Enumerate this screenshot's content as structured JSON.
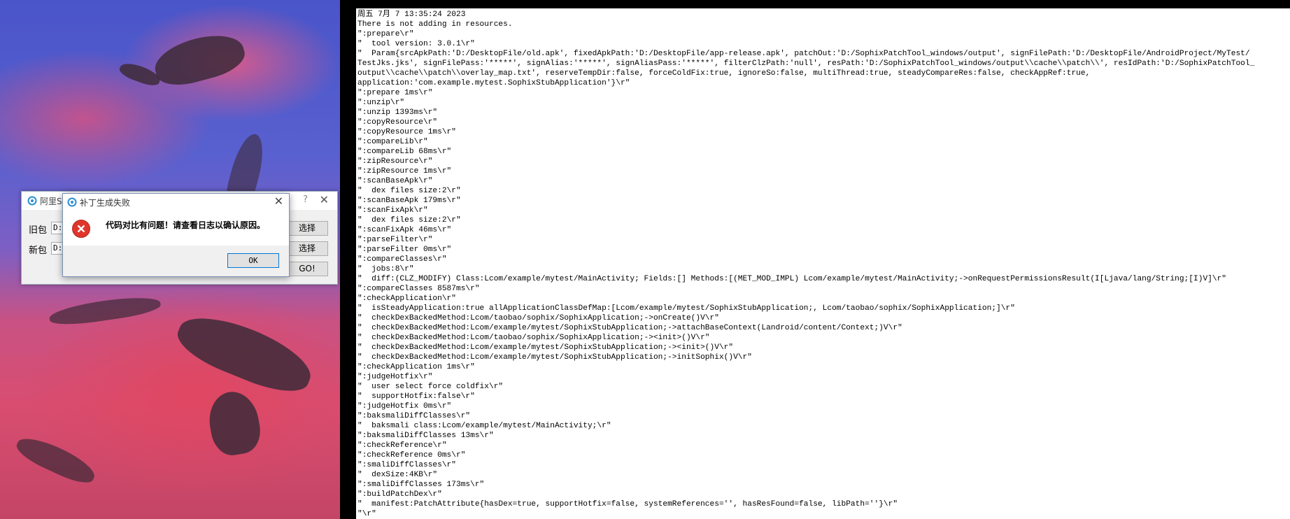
{
  "tool_window": {
    "title": "阿里S",
    "old_label": "旧包",
    "new_label": "新包",
    "old_path": "D:",
    "new_path": "D:",
    "select_button_1": "选择",
    "select_button_2": "选择",
    "go_button": "GO!",
    "help_icon": "question-icon",
    "close_icon": "close-icon"
  },
  "error_dialog": {
    "title": "补丁生成失败",
    "message": "代码对比有问题！请查看日志以确认原因。",
    "ok_button": "OK",
    "icon": "error-icon",
    "close_icon": "close-icon"
  },
  "console": {
    "lines": [
      "周五 7月 7 13:35:24 2023",
      "There is not adding in resources.",
      "\":prepare\\r\"",
      "\"  tool version: 3.0.1\\r\"",
      "\"  Param{srcApkPath:'D:/DesktopFile/old.apk', fixedApkPath:'D:/DesktopFile/app-release.apk', patchOut:'D:/SophixPatchTool_windows/output', signFilePath:'D:/DesktopFile/AndroidProject/MyTest/",
      "TestJks.jks', signFilePass:'*****', signAlias:'*****', signAliasPass:'*****', filterClzPath:'null', resPath:'D:/SophixPatchTool_windows/output\\\\cache\\\\patch\\\\', resIdPath:'D:/SophixPatchTool_",
      "output\\\\cache\\\\patch\\\\overlay_map.txt', reserveTempDir:false, forceColdFix:true, ignoreSo:false, multiThread:true, steadyCompareRes:false, checkAppRef:true,",
      "application:'com.example.mytest.SophixStubApplication'}\\r\"",
      "\":prepare 1ms\\r\"",
      "\":unzip\\r\"",
      "\":unzip 1393ms\\r\"",
      "\":copyResource\\r\"",
      "\":copyResource 1ms\\r\"",
      "\":compareLib\\r\"",
      "\":compareLib 68ms\\r\"",
      "\":zipResource\\r\"",
      "\":zipResource 1ms\\r\"",
      "\":scanBaseApk\\r\"",
      "\"  dex files size:2\\r\"",
      "\":scanBaseApk 179ms\\r\"",
      "\":scanFixApk\\r\"",
      "\"  dex files size:2\\r\"",
      "\":scanFixApk 46ms\\r\"",
      "\":parseFilter\\r\"",
      "\":parseFilter 0ms\\r\"",
      "\":compareClasses\\r\"",
      "\"  jobs:8\\r\"",
      "\"  diff:(CLZ_MODIFY) Class:Lcom/example/mytest/MainActivity; Fields:[] Methods:[(MET_MOD_IMPL) Lcom/example/mytest/MainActivity;->onRequestPermissionsResult(I[Ljava/lang/String;[I)V]\\r\"",
      "\":compareClasses 8587ms\\r\"",
      "\":checkApplication\\r\"",
      "\"  isSteadyApplication:true allApplicationClassDefMap:[Lcom/example/mytest/SophixStubApplication;, Lcom/taobao/sophix/SophixApplication;]\\r\"",
      "\"  checkDexBackedMethod:Lcom/taobao/sophix/SophixApplication;->onCreate()V\\r\"",
      "\"  checkDexBackedMethod:Lcom/example/mytest/SophixStubApplication;->attachBaseContext(Landroid/content/Context;)V\\r\"",
      "\"  checkDexBackedMethod:Lcom/taobao/sophix/SophixApplication;-><init>()V\\r\"",
      "\"  checkDexBackedMethod:Lcom/example/mytest/SophixStubApplication;-><init>()V\\r\"",
      "\"  checkDexBackedMethod:Lcom/example/mytest/SophixStubApplication;->initSophix()V\\r\"",
      "\":checkApplication 1ms\\r\"",
      "\":judgeHotfix\\r\"",
      "\"  user select force coldfix\\r\"",
      "\"  supportHotfix:false\\r\"",
      "\":judgeHotfix 0ms\\r\"",
      "\":baksmaliDiffClasses\\r\"",
      "\"  baksmali class:Lcom/example/mytest/MainActivity;\\r\"",
      "\":baksmaliDiffClasses 13ms\\r\"",
      "\":checkReference\\r\"",
      "\":checkReference 0ms\\r\"",
      "\":smaliDiffClasses\\r\"",
      "\"  dexSize:4KB\\r\"",
      "\":smaliDiffClasses 173ms\\r\"",
      "\":buildPatchDex\\r\"",
      "\"  manifest:PatchAttribute{hasDex=true, supportHotfix=false, systemReferences='', hasResFound=false, libPath=''}\\r\"",
      "\"\\r\""
    ]
  },
  "colors": {
    "error_red": "#e0352b",
    "focus_blue": "#0078d7",
    "console_bg": "#ffffff"
  }
}
